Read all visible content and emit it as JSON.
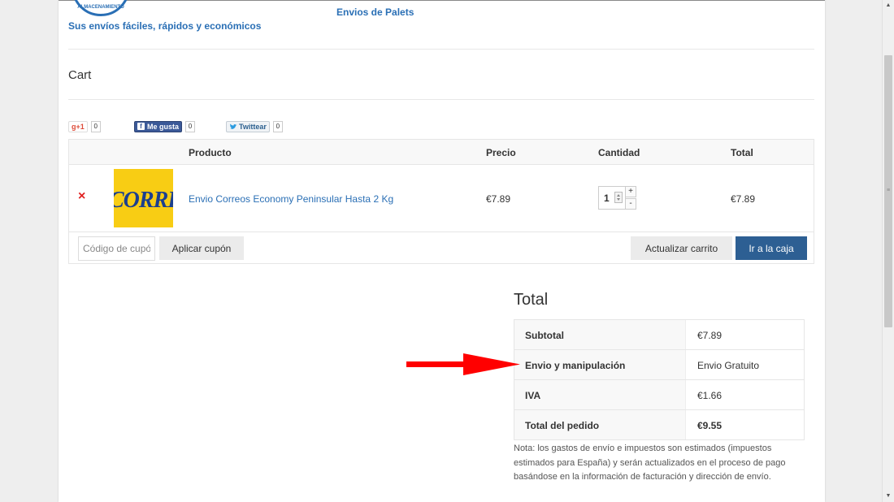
{
  "header": {
    "logo_text": "ALMACENAMIENTO",
    "tagline": "Sus envíos fáciles, rápidos y económicos",
    "nav_link": "Envios de Palets"
  },
  "page_title": "Cart",
  "social": {
    "gplus_label": "+1",
    "gplus_count": "0",
    "facebook_label": "Me gusta",
    "facebook_count": "0",
    "twitter_label": "Twittear",
    "twitter_count": "0"
  },
  "cart_table": {
    "headers": {
      "product": "Producto",
      "price": "Precio",
      "quantity": "Cantidad",
      "total": "Total"
    },
    "items": [
      {
        "remove_icon": "×",
        "thumb_text": "CORREOS",
        "product": "Envio Correos Economy Peninsular Hasta 2 Kg",
        "price": "€7.89",
        "quantity": "1",
        "total": "€7.89"
      }
    ],
    "qty_plus": "+",
    "qty_minus": "-"
  },
  "actions": {
    "coupon_placeholder": "Código de cupón",
    "apply_coupon": "Aplicar cupón",
    "update_cart": "Actualizar carrito",
    "checkout": "Ir a la caja"
  },
  "totals": {
    "title": "Total",
    "rows": [
      {
        "label": "Subtotal",
        "value": "€7.89"
      },
      {
        "label": "Envio y manipulación",
        "value": "Envio Gratuito"
      },
      {
        "label": "IVA",
        "value": "€1.66"
      },
      {
        "label": "Total del pedido",
        "value": "€9.55"
      }
    ],
    "note": "Nota: los gastos de envío e impuestos son estimados (impuestos estimados para España) y serán actualizados en el proceso de pago basándose en la información de facturación y dirección de envío."
  },
  "colors": {
    "brand_blue": "#2a6fb5",
    "checkout_button": "#2d5f93",
    "remove_red": "#e02020",
    "annotation_arrow": "#ff0000",
    "thumb_yellow": "#f8cd14"
  }
}
